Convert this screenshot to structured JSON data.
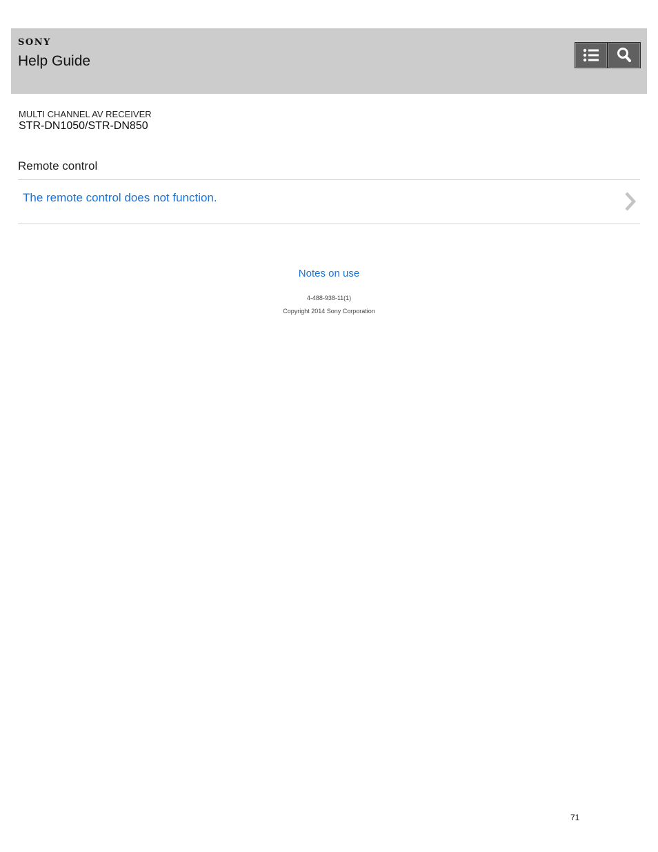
{
  "header": {
    "brand": "SONY",
    "title": "Help Guide",
    "toc_icon": "list-icon",
    "search_icon": "search-icon",
    "background_color": "#cccccc"
  },
  "product": {
    "category": "MULTI CHANNEL AV RECEIVER",
    "model": "STR-DN1050/STR-DN850"
  },
  "section": {
    "title": "Remote control",
    "topics": [
      {
        "label": "The remote control does not function.",
        "icon": "chevron-right-icon"
      }
    ]
  },
  "footer": {
    "notes_link": "Notes on use",
    "doc_number": "4-488-938-11(1)",
    "copyright": "Copyright 2014 Sony Corporation"
  },
  "page_number": "71",
  "colors": {
    "link": "#1a73d9",
    "button": "#606060"
  }
}
